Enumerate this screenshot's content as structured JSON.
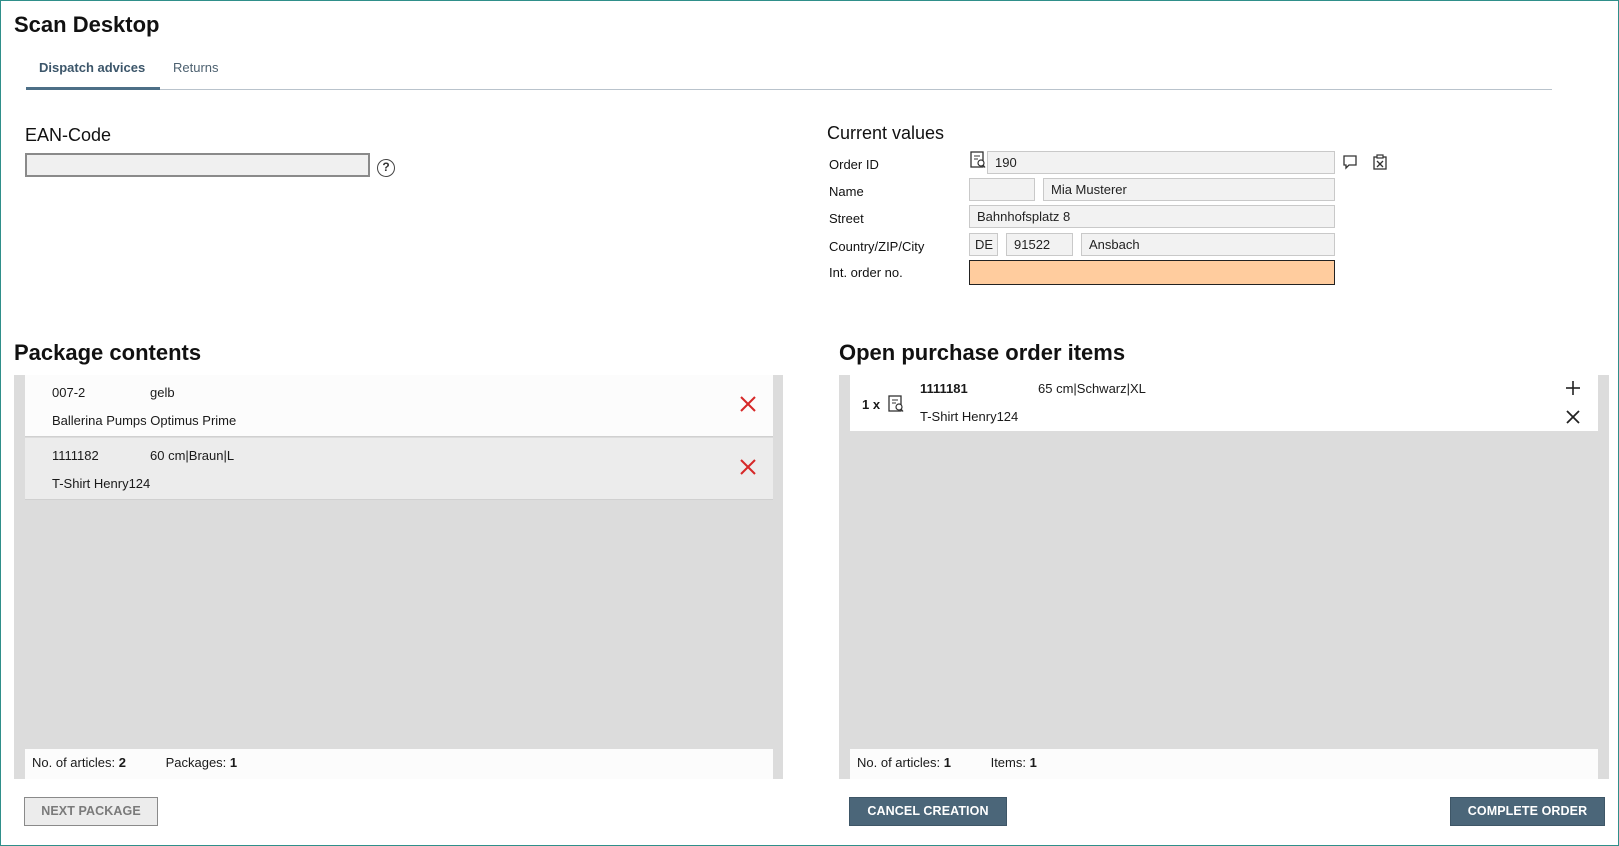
{
  "app": {
    "title": "Scan Desktop"
  },
  "tabs": [
    {
      "label": "Dispatch advices",
      "active": true
    },
    {
      "label": "Returns",
      "active": false
    }
  ],
  "ean": {
    "label": "EAN-Code",
    "value": "",
    "help_icon": "question-circle-icon"
  },
  "current_values": {
    "title": "Current values",
    "order_id": {
      "label": "Order ID",
      "value": "190"
    },
    "name": {
      "label": "Name",
      "salutation": "",
      "value": "Mia Musterer"
    },
    "street": {
      "label": "Street",
      "value": "Bahnhofsplatz 8"
    },
    "country_zip_city": {
      "label": "Country/ZIP/City",
      "country": "DE",
      "zip": "91522",
      "city": "Ansbach"
    },
    "int_order_no": {
      "label": "Int. order no.",
      "value": "",
      "highlight_color": "#ffcc9e"
    }
  },
  "package_contents": {
    "title": "Package contents",
    "items": [
      {
        "code": "007-2",
        "variant": "gelb",
        "article": "Ballerina Pumps Optimus Prime"
      },
      {
        "code": "1111182",
        "variant": "60 cm|Braun|L",
        "article": "T-Shirt Henry124"
      }
    ],
    "footer": {
      "articles_label": "No. of articles:",
      "articles_value": "2",
      "packages_label": "Packages:",
      "packages_value": "1"
    }
  },
  "open_po": {
    "title": "Open purchase order items",
    "items": [
      {
        "qty": "1 x",
        "code": "1111181",
        "variant": "65 cm|Schwarz|XL",
        "article": "T-Shirt Henry124"
      }
    ],
    "footer": {
      "articles_label": "No. of articles:",
      "articles_value": "1",
      "items_label": "Items:",
      "items_value": "1"
    }
  },
  "buttons": {
    "next_package": "NEXT PACKAGE",
    "cancel_creation": "CANCEL CREATION",
    "complete_order": "COMPLETE ORDER"
  },
  "colors": {
    "accent": "#4b6679",
    "remove_red": "#d62828",
    "panel_bg": "#dcdcdc"
  }
}
